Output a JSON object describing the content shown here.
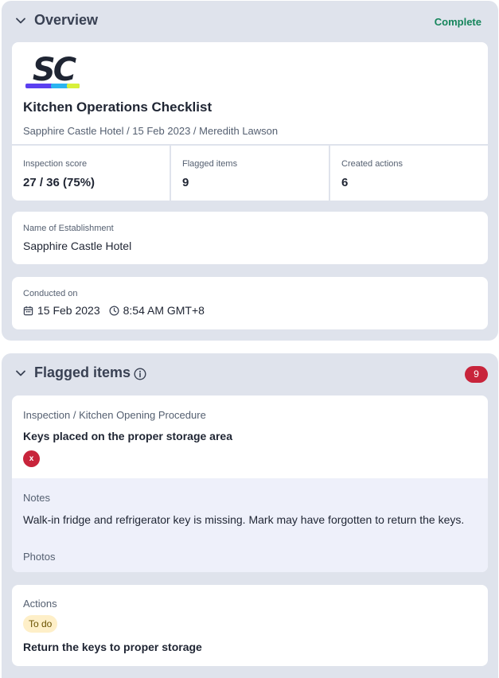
{
  "overview": {
    "title": "Overview",
    "status": "Complete",
    "logo_text": "SC",
    "doc_title": "Kitchen Operations Checklist",
    "doc_meta": "Sapphire Castle Hotel / 15 Feb 2023 / Meredith Lawson",
    "stats": [
      {
        "label": "Inspection score",
        "value": "27 / 36 (75%)"
      },
      {
        "label": "Flagged items",
        "value": "9"
      },
      {
        "label": "Created actions",
        "value": "6"
      }
    ],
    "establishment": {
      "label": "Name of Establishment",
      "value": "Sapphire Castle Hotel"
    },
    "conducted": {
      "label": "Conducted on",
      "date": "15 Feb 2023",
      "time": "8:54 AM GMT+8"
    }
  },
  "flagged": {
    "title": "Flagged items",
    "count": "9",
    "item": {
      "path": "Inspection / Kitchen Opening Procedure",
      "question": "Keys placed on the proper storage area",
      "response": "x",
      "notes_label": "Notes",
      "notes_text": "Walk-in fridge and refrigerator key is missing. Mark may have forgotten to return the keys.",
      "photos_label": "Photos"
    },
    "actions": {
      "label": "Actions",
      "status": "To do",
      "title": "Return the keys to proper storage"
    }
  },
  "colors": {
    "section_bg": "#dfe3ec",
    "complete_green": "#15855b",
    "flag_red": "#c8243b",
    "notes_bg": "#eef0fa",
    "todo_bg": "#feefc8"
  },
  "icons": [
    "chevron-down-icon",
    "calendar-icon",
    "clock-icon",
    "info-icon"
  ]
}
